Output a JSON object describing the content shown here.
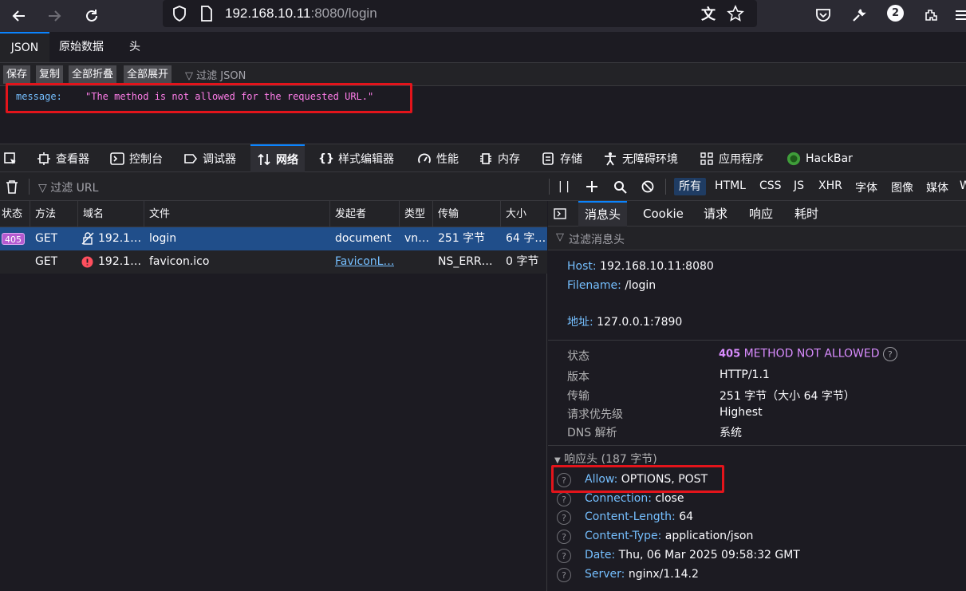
{
  "browser": {
    "url_host": "192.168.10.11",
    "url_rest": ":8080/login",
    "notification_count": "2"
  },
  "json_viewer": {
    "tabs": [
      "JSON",
      "原始数据",
      "头"
    ],
    "buttons": [
      "保存",
      "复制",
      "全部折叠",
      "全部展开"
    ],
    "filter_placeholder": "过滤 JSON",
    "key": "message:",
    "value": "\"The method is not allowed for the requested URL.\""
  },
  "devtools": {
    "tabs": [
      "查看器",
      "控制台",
      "调试器",
      "网络",
      "样式编辑器",
      "性能",
      "内存",
      "存储",
      "无障碍环境",
      "应用程序",
      "HackBar"
    ],
    "active_tab": "网络",
    "filter_url": "过滤 URL",
    "type_filters": [
      "所有",
      "HTML",
      "CSS",
      "JS",
      "XHR",
      "字体",
      "图像",
      "媒体",
      "W"
    ]
  },
  "requests": {
    "columns": [
      "状态",
      "方法",
      "域名",
      "文件",
      "发起者",
      "类型",
      "传输",
      "大小"
    ],
    "rows": [
      {
        "status": "405",
        "method": "GET",
        "domain": "192.1…",
        "file": "login",
        "initiator": "document",
        "type": "vn…",
        "transfer": "251 字节",
        "size": "64 字…"
      },
      {
        "status": "",
        "method": "GET",
        "domain": "192.1…",
        "file": "favicon.ico",
        "initiator": "FaviconL…",
        "type": "",
        "transfer": "NS_ERR…",
        "size": "0 字节"
      }
    ]
  },
  "details": {
    "tabs": [
      "消息头",
      "Cookie",
      "请求",
      "响应",
      "耗时"
    ],
    "filter": "过滤消息头",
    "host_label": "Host:",
    "host_value": "192.168.10.11:8080",
    "filename_label": "Filename:",
    "filename_value": "/login",
    "address_label": "地址:",
    "address_value": "127.0.0.1:7890",
    "status_label": "状态",
    "status_code": "405",
    "status_text": "METHOD NOT ALLOWED",
    "version_label": "版本",
    "version_value": "HTTP/1.1",
    "transfer_label": "传输",
    "transfer_value": "251 字节（大小 64 字节）",
    "priority_label": "请求优先级",
    "priority_value": "Highest",
    "dns_label": "DNS 解析",
    "dns_value": "系统",
    "resp_headers_title": "响应头 (187 字节)",
    "resp_headers": [
      {
        "name": "Allow:",
        "value": "OPTIONS, POST"
      },
      {
        "name": "Connection:",
        "value": "close"
      },
      {
        "name": "Content-Length:",
        "value": "64"
      },
      {
        "name": "Content-Type:",
        "value": "application/json"
      },
      {
        "name": "Date:",
        "value": "Thu, 06 Mar 2025 09:58:32 GMT"
      },
      {
        "name": "Server:",
        "value": "nginx/1.14.2"
      }
    ]
  },
  "colors": {
    "accent": "#0a84ff",
    "highlight": "#e3141b",
    "selected_row": "#204e8a",
    "status_badge": "#b55bd0"
  }
}
